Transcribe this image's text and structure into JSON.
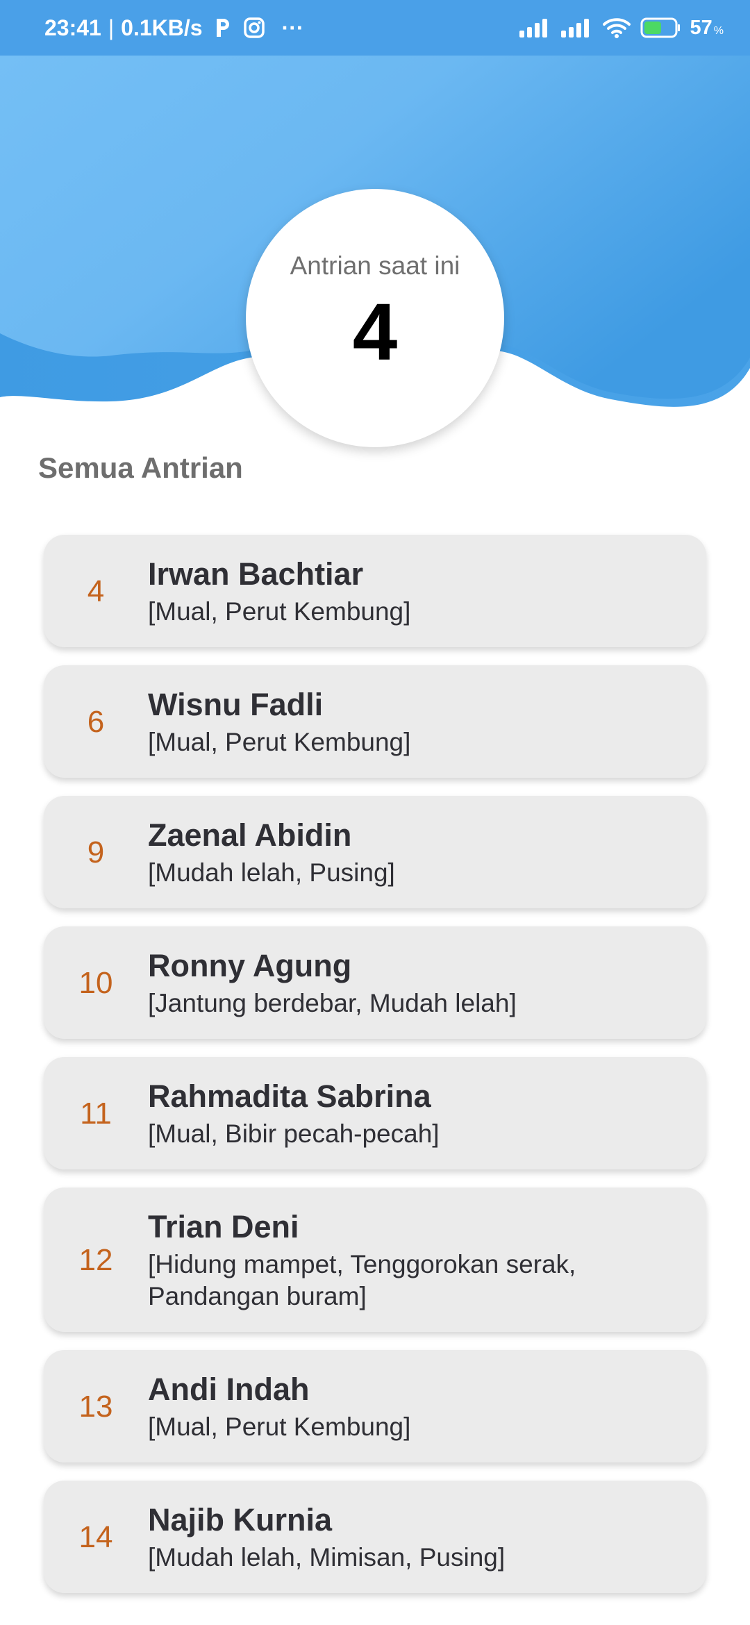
{
  "status_bar": {
    "time": "23:41",
    "network_speed": "0.1KB/s",
    "separator": "|",
    "more": "···",
    "battery_percent": "57",
    "battery_unit": "%",
    "icons": [
      "parking-app-icon",
      "instagram-icon",
      "signal-icon",
      "signal-icon",
      "wifi-icon",
      "battery-icon"
    ],
    "battery_level": 0.57,
    "battery_color": "#4cd964"
  },
  "current_queue": {
    "label": "Antrian saat ini",
    "number": "4"
  },
  "section_title": "Semua Antrian",
  "colors": {
    "header_blue_light": "#74bff5",
    "header_blue_dark": "#3f9be3",
    "queue_number": "#c4631d",
    "card_bg": "#ebebeb"
  },
  "queue": [
    {
      "number": "4",
      "name": "Irwan Bachtiar",
      "complaints": "[Mual, Perut Kembung]"
    },
    {
      "number": "6",
      "name": "Wisnu Fadli",
      "complaints": "[Mual, Perut Kembung]"
    },
    {
      "number": "9",
      "name": "Zaenal Abidin",
      "complaints": "[Mudah lelah, Pusing]"
    },
    {
      "number": "10",
      "name": "Ronny Agung",
      "complaints": "[Jantung berdebar, Mudah lelah]"
    },
    {
      "number": "11",
      "name": "Rahmadita Sabrina",
      "complaints": "[Mual, Bibir pecah-pecah]"
    },
    {
      "number": "12",
      "name": "Trian Deni",
      "complaints": "[Hidung mampet, Tenggorokan serak, Pandangan buram]"
    },
    {
      "number": "13",
      "name": "Andi Indah",
      "complaints": "[Mual, Perut Kembung]"
    },
    {
      "number": "14",
      "name": "Najib Kurnia",
      "complaints": "[Mudah lelah, Mimisan, Pusing]"
    }
  ]
}
